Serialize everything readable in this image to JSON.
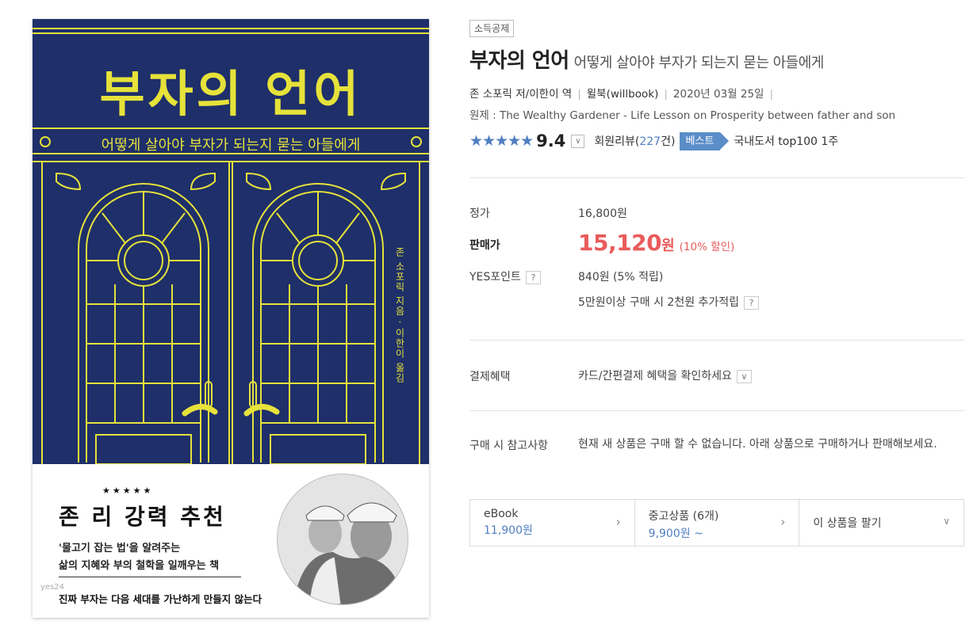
{
  "cover": {
    "title": "부자의 언어",
    "subtitle": "어떻게 살아야 부자가 되는지 묻는 아들에게",
    "vertical_credit": "존 소포릭 지음 · 이한이 옮김",
    "stars_deco": "★★★★★",
    "recommend_title": "존 리 강력 추천",
    "recommend_line1": "'물고기 잡는 법'을 알려주는",
    "recommend_line2": "삶의 지혜와 부의 철학을 일깨우는 책",
    "bottom_line": "진짜 부자는 다음 세대를 가난하게 만들지 않는다",
    "watermark": "yes24"
  },
  "product": {
    "badge": "소득공제",
    "title": "부자의 언어",
    "subtitle": "어떻게 살아야 부자가 되는지 묻는 아들에게",
    "author": "존 소포릭 저/이한이 역",
    "publisher": "윌북(willbook)",
    "date": "2020년 03월 25일",
    "original_title": "원제 : The Wealthy Gardener - Life Lesson on Prosperity between father and son",
    "stars": "★★★★★",
    "score": "9.4",
    "review_label": "회원리뷰(",
    "review_count": "227",
    "review_suffix": "건)",
    "best_label": "베스트",
    "rank_text": "국내도서 top100 1주"
  },
  "pricing": {
    "list_label": "정가",
    "list_price": "16,800원",
    "sale_label": "판매가",
    "sale_price": "15,120",
    "sale_won": "원",
    "discount": "(10% 할인)",
    "points_label": "YES포인트",
    "points_value": "840원 (5% 적립)",
    "points_extra": "5만원이상 구매 시 2천원 추가적립",
    "help_mark": "?"
  },
  "payment": {
    "label": "결제혜택",
    "value": "카드/간편결제 혜택을 확인하세요"
  },
  "note": {
    "label": "구매 시 참고사항",
    "text": "현재 새 상품은 구매 할 수 없습니다. 아래 상품으로 구매하거나 판매해보세요."
  },
  "tabs": [
    {
      "name": "eBook",
      "price": "11,900원"
    },
    {
      "name": "중고상품 (6개)",
      "price": "9,900원 ~"
    },
    {
      "name": "이 상품을 팔기"
    }
  ],
  "colors": {
    "cover_navy": "#1e2f6a",
    "cover_yellow": "#e6e23a",
    "sale_red": "#e95b5b",
    "link_blue": "#4f7fc1"
  }
}
